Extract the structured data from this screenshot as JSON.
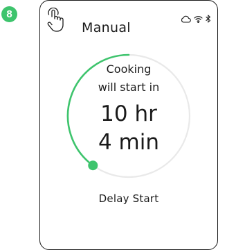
{
  "step": {
    "number": "8"
  },
  "header": {
    "mode_title": "Manual"
  },
  "status": {
    "icons": [
      "cloud-icon",
      "wifi-icon",
      "bluetooth-icon"
    ]
  },
  "timer": {
    "line1": "Cooking",
    "line2": "will start in",
    "hours_text": "10 hr",
    "minutes_text": "4 min",
    "progress_fraction": 0.4
  },
  "footer": {
    "label": "Delay Start"
  },
  "colors": {
    "accent": "#3ec46d",
    "track": "#e9e9e9",
    "text": "#1a1a1a"
  }
}
